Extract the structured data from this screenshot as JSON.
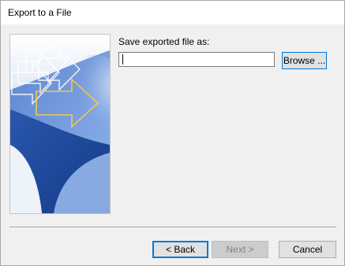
{
  "window": {
    "title": "Export to a File"
  },
  "form": {
    "label": "Save exported file as:",
    "file_path_value": "",
    "browse_label": "Browse ..."
  },
  "footer": {
    "back_label": "< Back",
    "next_label": "Next >",
    "next_enabled": false,
    "cancel_label": "Cancel"
  },
  "colors": {
    "dialog_background": "#f0f0f0",
    "title_bar": "#ffffff",
    "focus_border": "#0078d7",
    "button_face": "#e1e1e1",
    "disabled_button_face": "#cccccc",
    "disabled_text": "#838383",
    "wizard_blue_dark": "#1c4696",
    "wizard_blue_light": "#8fb4ee",
    "wizard_arrow_gold": "#f2c84b"
  },
  "icons": {
    "wizard_image": "export-wizard-arrows-graphic"
  }
}
